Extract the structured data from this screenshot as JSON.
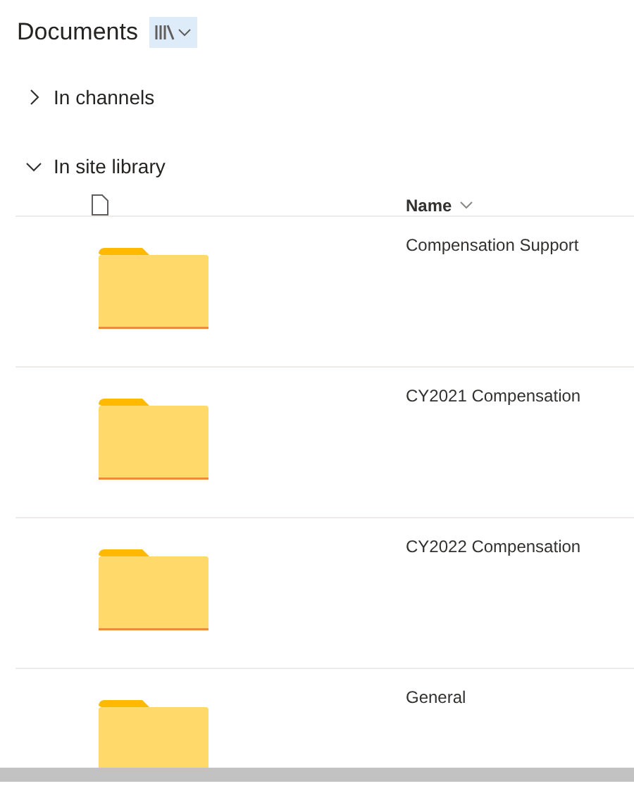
{
  "title": "Documents",
  "sections": [
    {
      "label": "In channels",
      "expanded": false
    },
    {
      "label": "In site library",
      "expanded": true
    }
  ],
  "table": {
    "columns": [
      "Name"
    ],
    "rows": [
      {
        "name": "Compensation Support"
      },
      {
        "name": "CY2021 Compensation"
      },
      {
        "name": "CY2022 Compensation"
      },
      {
        "name": "General"
      }
    ]
  }
}
